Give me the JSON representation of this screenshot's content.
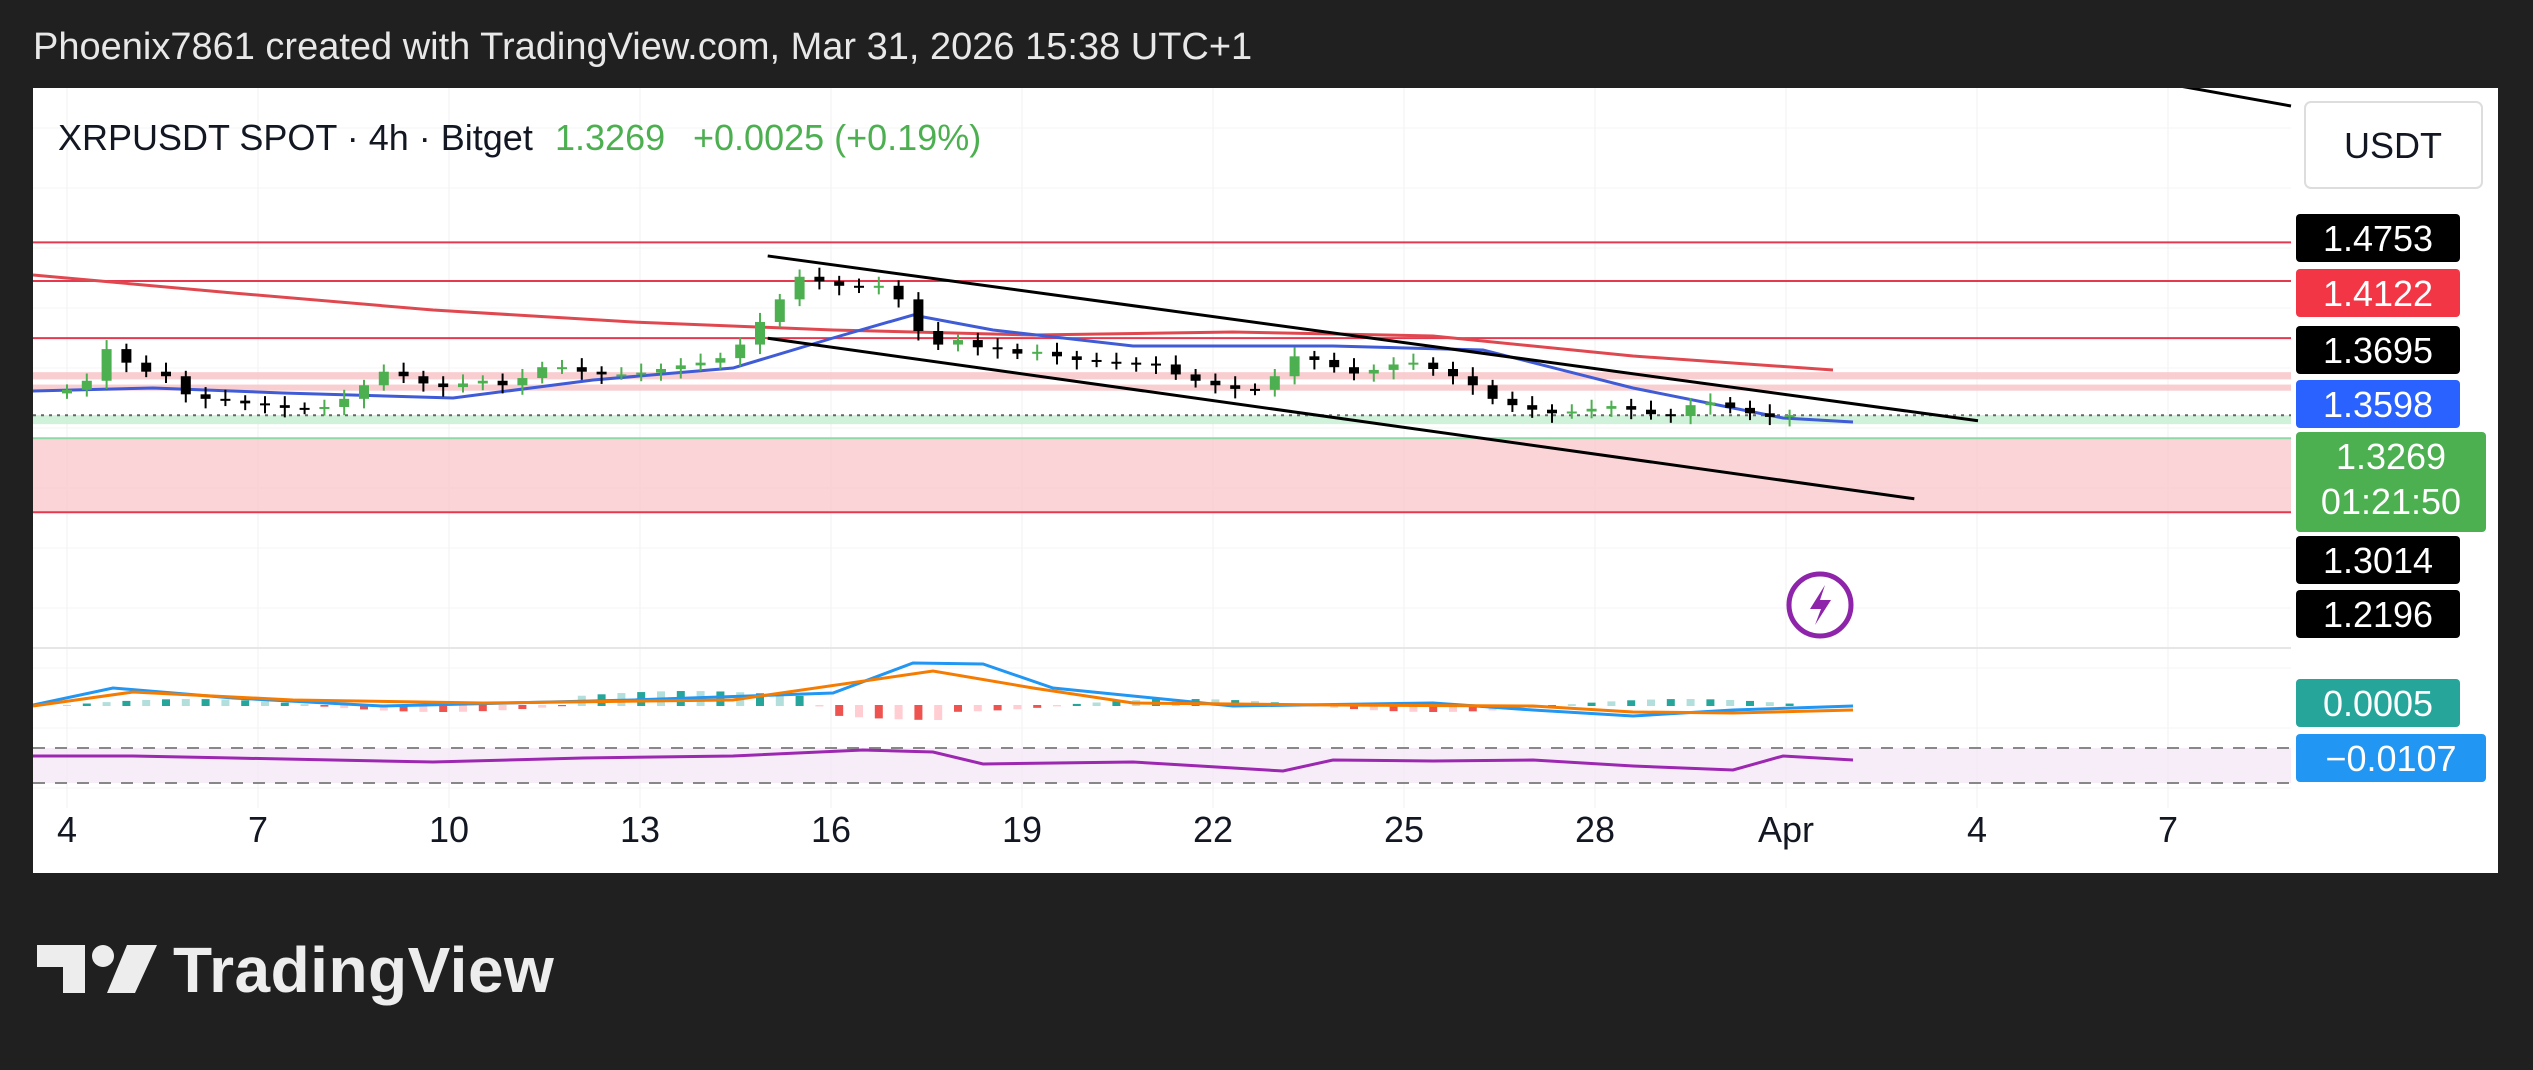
{
  "header": {
    "caption": "Phoenix7861 created with TradingView.com, Mar 31, 2026 15:38 UTC+1"
  },
  "branding": {
    "logo_text": "TradingView",
    "logo_icon": "tradingview-logo-icon"
  },
  "legend": {
    "symbol_line": "XRPUSDT SPOT · 4h · Bitget",
    "last_price": "1.3269",
    "change": "+0.0025 (+0.19%)"
  },
  "price_scale": {
    "currency": "USDT"
  },
  "colors": {
    "up": "#4caf50",
    "down": "#000000",
    "ma_red": "#e04850",
    "ma_blue": "#3f5bd6",
    "macd": "#2196f3",
    "signal": "#f57c00",
    "rsi": "#9c27b0",
    "zone_red": "#f8c5c9",
    "zone_green": "#c9f0d4",
    "line_red": "#e53950",
    "line_green": "#8fd9a8",
    "alert": "#8e24aa"
  },
  "chart_data": {
    "type": "candlestick",
    "title": "XRPUSDT SPOT · 4h · Bitget",
    "x_tick_labels": [
      "4",
      "7",
      "10",
      "13",
      "16",
      "19",
      "22",
      "25",
      "28",
      "Apr",
      "4",
      "7"
    ],
    "price_axis_labels": [
      {
        "value": "1.4753",
        "bg": "#000000"
      },
      {
        "value": "1.4122",
        "bg": "#f23645"
      },
      {
        "value": "1.3695",
        "bg": "#000000"
      },
      {
        "value": "1.3598",
        "bg": "#2962ff"
      },
      {
        "value": "1.3269",
        "bg": "#4caf50",
        "countdown": "01:21:50"
      },
      {
        "value": "1.3014",
        "bg": "#000000"
      },
      {
        "value": "1.2196",
        "bg": "#000000"
      }
    ],
    "indicator_axis_labels": [
      {
        "value": "0.0005",
        "bg": "#26a69a"
      },
      {
        "value": "−0.0107",
        "bg": "#2196f3"
      }
    ],
    "horizontal_levels": [
      1.4753,
      1.4122,
      1.3695,
      1.3598,
      1.3014,
      1.2196
    ],
    "zones": [
      {
        "from": 1.3745,
        "to": 1.3665,
        "kind": "resistance"
      },
      {
        "from": 1.3608,
        "to": 1.354,
        "kind": "resistance"
      },
      {
        "from": 1.327,
        "to": 1.317,
        "kind": "support"
      },
      {
        "from": 1.3014,
        "to": 1.2196,
        "kind": "demand"
      }
    ],
    "channel": {
      "upper": [
        [
          "Mar 15",
          1.503
        ],
        [
          "Apr 3",
          1.3208
        ]
      ],
      "lower": [
        [
          "Mar 15",
          1.412
        ],
        [
          "Apr 2",
          1.2345
        ]
      ]
    },
    "candles_close_approx": [
      1.355,
      1.365,
      1.4,
      1.385,
      1.375,
      1.37,
      1.35,
      1.345,
      1.343,
      1.34,
      1.338,
      1.335,
      1.334,
      1.336,
      1.345,
      1.36,
      1.375,
      1.37,
      1.362,
      1.358,
      1.362,
      1.365,
      1.36,
      1.368,
      1.38,
      1.38,
      1.375,
      1.372,
      1.372,
      1.374,
      1.378,
      1.382,
      1.385,
      1.39,
      1.405,
      1.43,
      1.455,
      1.48,
      1.475,
      1.47,
      1.468,
      1.47,
      1.455,
      1.42,
      1.405,
      1.41,
      1.402,
      1.4,
      1.395,
      1.397,
      1.392,
      1.388,
      1.386,
      1.385,
      1.384,
      1.383,
      1.372,
      1.365,
      1.36,
      1.356,
      1.355,
      1.37,
      1.392,
      1.388,
      1.38,
      1.373,
      1.377,
      1.383,
      1.385,
      1.378,
      1.37,
      1.36,
      1.345,
      1.338,
      1.333,
      1.329,
      1.331,
      1.334,
      1.337,
      1.333,
      1.328,
      1.326,
      1.338,
      1.341,
      1.335,
      1.329,
      1.325,
      1.327
    ],
    "current_price": 1.3269,
    "countdown": "01:21:50",
    "legend_placement": "top-left"
  }
}
